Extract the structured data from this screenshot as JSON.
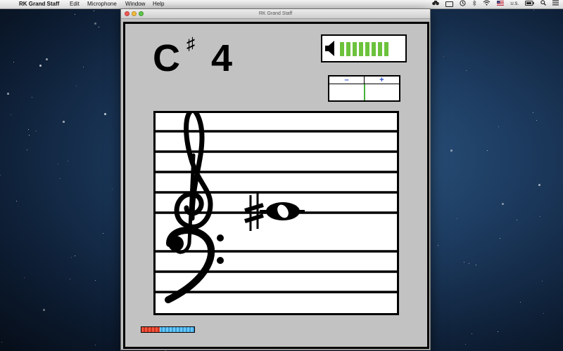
{
  "menubar": {
    "app_name": "RK Grand Staff",
    "items": [
      "Edit",
      "Microphone",
      "Window",
      "Help"
    ],
    "status": {
      "input_source_label": "U.S."
    }
  },
  "window": {
    "title": "RK Grand Staff"
  },
  "note": {
    "letter": "C",
    "accidental": "♯",
    "octave": "4"
  },
  "volume": {
    "bar_count": 8,
    "bar_color": "#6cc23c"
  },
  "tuner": {
    "minus_label": "–",
    "plus_label": "+",
    "needle_color": "#43b23a"
  },
  "staff": {
    "clefs": [
      "treble-clef",
      "bass-clef"
    ],
    "note_accidental": "♯",
    "note_type": "whole-note"
  },
  "input_level": {
    "fraction": 0.34,
    "fill_color": "#f1553c",
    "empty_color": "#67c8f4"
  }
}
